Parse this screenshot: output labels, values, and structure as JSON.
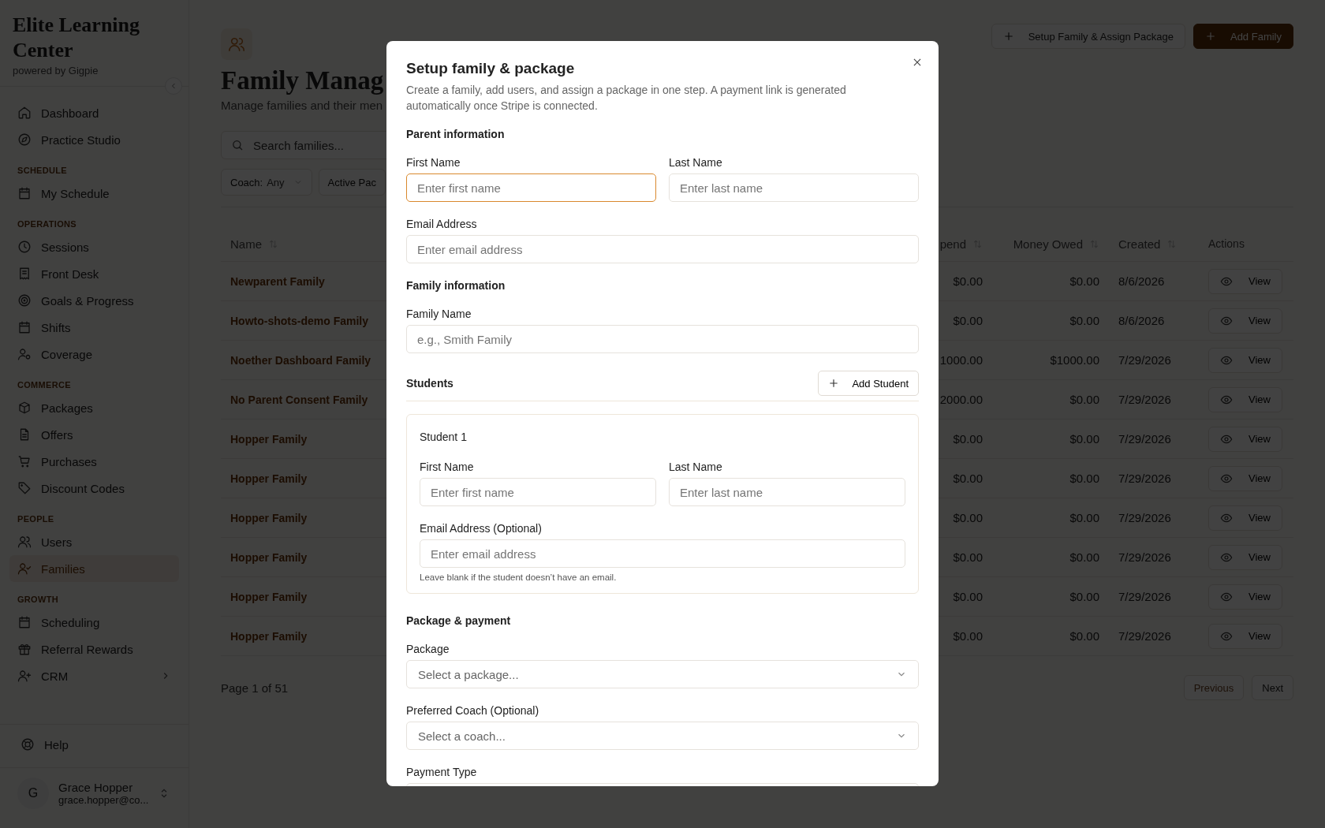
{
  "sidebar": {
    "brand": "Elite Learning Center",
    "tagline": "powered by Gigpie",
    "groups": [
      {
        "items": [
          {
            "label": "Dashboard",
            "selected": false
          },
          {
            "label": "Practice Studio",
            "selected": false
          }
        ]
      },
      {
        "label": "SCHEDULE",
        "items": [
          {
            "label": "My Schedule",
            "selected": false
          }
        ]
      },
      {
        "label": "OPERATIONS",
        "items": [
          {
            "label": "Sessions",
            "selected": false
          },
          {
            "label": "Front Desk",
            "selected": false
          },
          {
            "label": "Goals & Progress",
            "selected": false
          },
          {
            "label": "Shifts",
            "selected": false
          },
          {
            "label": "Coverage",
            "selected": false
          }
        ]
      },
      {
        "label": "COMMERCE",
        "items": [
          {
            "label": "Packages",
            "selected": false
          },
          {
            "label": "Offers",
            "selected": false
          },
          {
            "label": "Purchases",
            "selected": false
          },
          {
            "label": "Discount Codes",
            "selected": false
          }
        ]
      },
      {
        "label": "PEOPLE",
        "items": [
          {
            "label": "Users",
            "selected": false
          },
          {
            "label": "Families",
            "selected": true
          }
        ]
      },
      {
        "label": "GROWTH",
        "items": [
          {
            "label": "Scheduling",
            "selected": false
          },
          {
            "label": "Referral Rewards",
            "selected": false
          },
          {
            "label": "CRM",
            "selected": false,
            "expanded": false
          }
        ]
      }
    ],
    "help": "Help",
    "user": {
      "initial": "G",
      "name": "Grace Hopper",
      "email": "grace.hopper@co..."
    }
  },
  "header": {
    "title": "Family Manag",
    "subtitle": "Manage families and their men",
    "buttons": [
      {
        "label": "Setup Family & Assign Package",
        "kind": "outline"
      },
      {
        "label": "Add Family",
        "kind": "primary"
      }
    ]
  },
  "search": {
    "placeholder": "Search families..."
  },
  "filters": [
    {
      "label": "Coach:",
      "value": "Any"
    },
    {
      "label": "Active Pac"
    }
  ],
  "table": {
    "columns": [
      "Name",
      "pend",
      "Money Owed",
      "Created",
      "Actions"
    ],
    "rows": [
      {
        "name": "Newparent Family",
        "spend": "$0.00",
        "owed": "$0.00",
        "created": "8/6/2026",
        "action": "View"
      },
      {
        "name": "Howto-shots-demo Family",
        "spend": "$0.00",
        "owed": "$0.00",
        "created": "8/6/2026",
        "action": "View"
      },
      {
        "name": "Noether Dashboard Family",
        "spend": "1000.00",
        "owed": "$1000.00",
        "created": "7/29/2026",
        "action": "View"
      },
      {
        "name": "No Parent Consent Family",
        "spend": "2000.00",
        "owed": "$0.00",
        "created": "7/29/2026",
        "action": "View"
      },
      {
        "name": "Hopper Family",
        "spend": "$0.00",
        "owed": "$0.00",
        "created": "7/29/2026",
        "action": "View"
      },
      {
        "name": "Hopper Family",
        "spend": "$0.00",
        "owed": "$0.00",
        "created": "7/29/2026",
        "action": "View"
      },
      {
        "name": "Hopper Family",
        "spend": "$0.00",
        "owed": "$0.00",
        "created": "7/29/2026",
        "action": "View"
      },
      {
        "name": "Hopper Family",
        "spend": "$0.00",
        "owed": "$0.00",
        "created": "7/29/2026",
        "action": "View"
      },
      {
        "name": "Hopper Family",
        "spend": "$0.00",
        "owed": "$0.00",
        "created": "7/29/2026",
        "action": "View"
      },
      {
        "name": "Hopper Family",
        "spend": "$0.00",
        "owed": "$0.00",
        "created": "7/29/2026",
        "action": "View"
      }
    ]
  },
  "pagination": {
    "text": "Page 1 of 51",
    "previous": {
      "label": "Previous",
      "disabled": true
    },
    "next": {
      "label": "Next",
      "disabled": false
    }
  },
  "modal": {
    "title": "Setup family & package",
    "description": "Create a family, add users, and assign a package in one step. A payment link is generated automatically once Stripe is connected.",
    "parent": {
      "heading": "Parent information",
      "first_name": {
        "label": "First Name",
        "placeholder": "Enter first name",
        "focused": true
      },
      "last_name": {
        "label": "Last Name",
        "placeholder": "Enter last name",
        "focused": false
      },
      "email": {
        "label": "Email Address",
        "placeholder": "Enter email address",
        "focused": false
      }
    },
    "family": {
      "heading": "Family information",
      "family_name": {
        "label": "Family Name",
        "placeholder": "e.g., Smith Family",
        "focused": false
      }
    },
    "students": {
      "heading": "Students",
      "add_button": "Add Student",
      "items": [
        {
          "title": "Student 1",
          "first_name": {
            "label": "First Name",
            "placeholder": "Enter first name",
            "focused": false
          },
          "last_name": {
            "label": "Last Name",
            "placeholder": "Enter last name",
            "focused": false
          },
          "email": {
            "label": "Email Address (Optional)",
            "placeholder": "Enter email address",
            "focused": false
          },
          "hint": "Leave blank if the student doesn’t have an email."
        }
      ]
    },
    "package": {
      "heading": "Package & payment",
      "package": {
        "label": "Package",
        "placeholder": "Select a package..."
      },
      "coach": {
        "label": "Preferred Coach (Optional)",
        "placeholder": "Select a coach..."
      },
      "payment_type": {
        "label": "Payment Type"
      }
    }
  }
}
